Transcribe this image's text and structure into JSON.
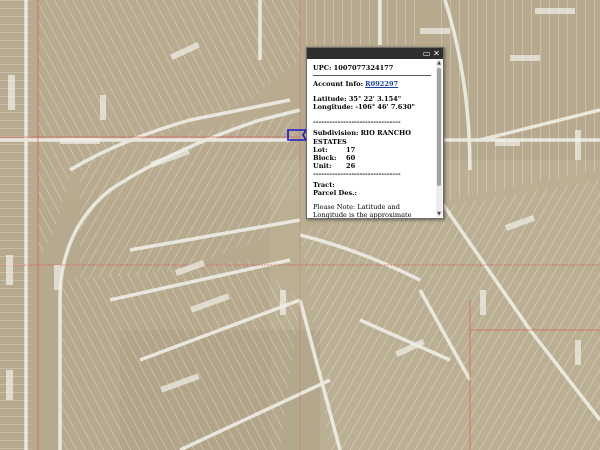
{
  "popup": {
    "upc": "UPC: 1007077324177",
    "account_label": "Account Info:",
    "account_link": "R092297",
    "latitude": "Latitude: 35° 22' 3.154\"",
    "longitude": "Longitude: -106° 46' 7.630\"",
    "divider_dashes": "--------------------------------",
    "subdivision_label": "Subdivision:",
    "subdivision_value": "RIO RANCHO ESTATES",
    "lot_label": "Lot:",
    "lot_value": "17",
    "block_label": "Block:",
    "block_value": "60",
    "unit_label": "Unit:",
    "unit_value": "26",
    "tract_label": "Tract:",
    "parcel_label": "Parcel Des.:",
    "note": "Please Note: Latitude and Longitude is the approximate center of the parcel shown.",
    "maximize_icon": "window-maximize-icon",
    "close_icon": "close-icon"
  },
  "colors": {
    "terrain": "#b8ab8f",
    "parcel_line": "#f2f2ec",
    "boundary_red": "#d9534f",
    "selection_blue": "#1a1acc",
    "popup_titlebar": "#2e2e2e"
  }
}
